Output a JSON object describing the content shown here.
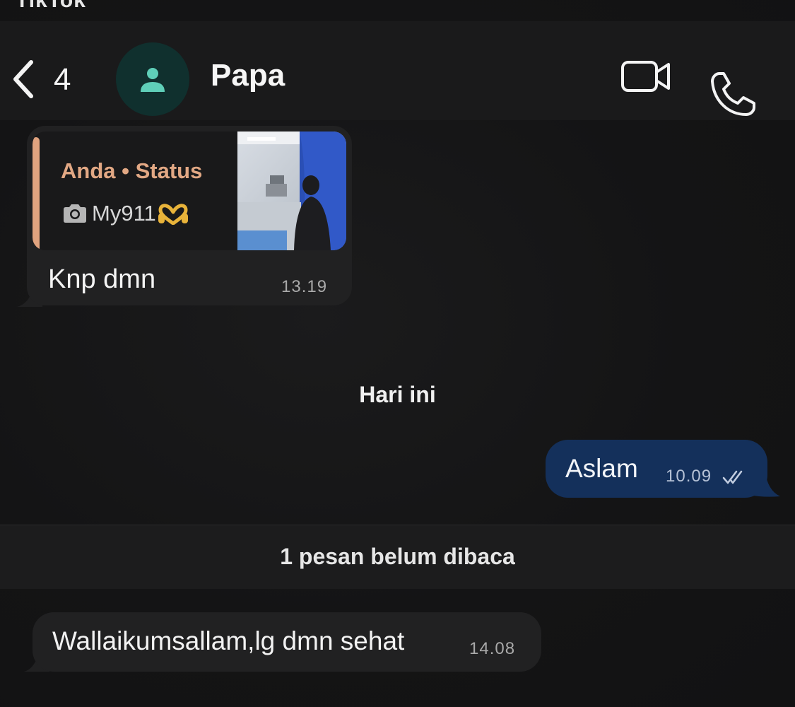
{
  "overlay": {
    "watermark": "TikTok"
  },
  "header": {
    "unread_count": "4",
    "contact_name": "Papa",
    "back_icon": "chevron-left-icon",
    "avatar_icon": "person-icon",
    "video_icon": "video-camera-icon",
    "call_icon": "phone-icon"
  },
  "messages": [
    {
      "direction": "incoming",
      "reply_to": {
        "author": "Anda • Status",
        "media_icon": "camera-icon",
        "caption": "My911",
        "caption_emoji": "heart-hands-icon"
      },
      "text": "Knp dmn",
      "time": "13.19"
    },
    {
      "direction": "outgoing",
      "text": "Aslam",
      "time": "10.09",
      "status_icon": "double-check-icon"
    },
    {
      "direction": "incoming",
      "text": "Wallaikumsallam,lg dmn sehat",
      "time": "14.08"
    }
  ],
  "date_divider": "Hari ini",
  "unread_banner": "1 pesan belum dibaca",
  "colors": {
    "background": "#131314",
    "header": "#1a1a1b",
    "incoming_bubble": "#212122",
    "outgoing_bubble": "#14305b",
    "quote_accent": "#e0a37f",
    "avatar_bg": "#10302e",
    "avatar_fg": "#5fcfb8"
  }
}
